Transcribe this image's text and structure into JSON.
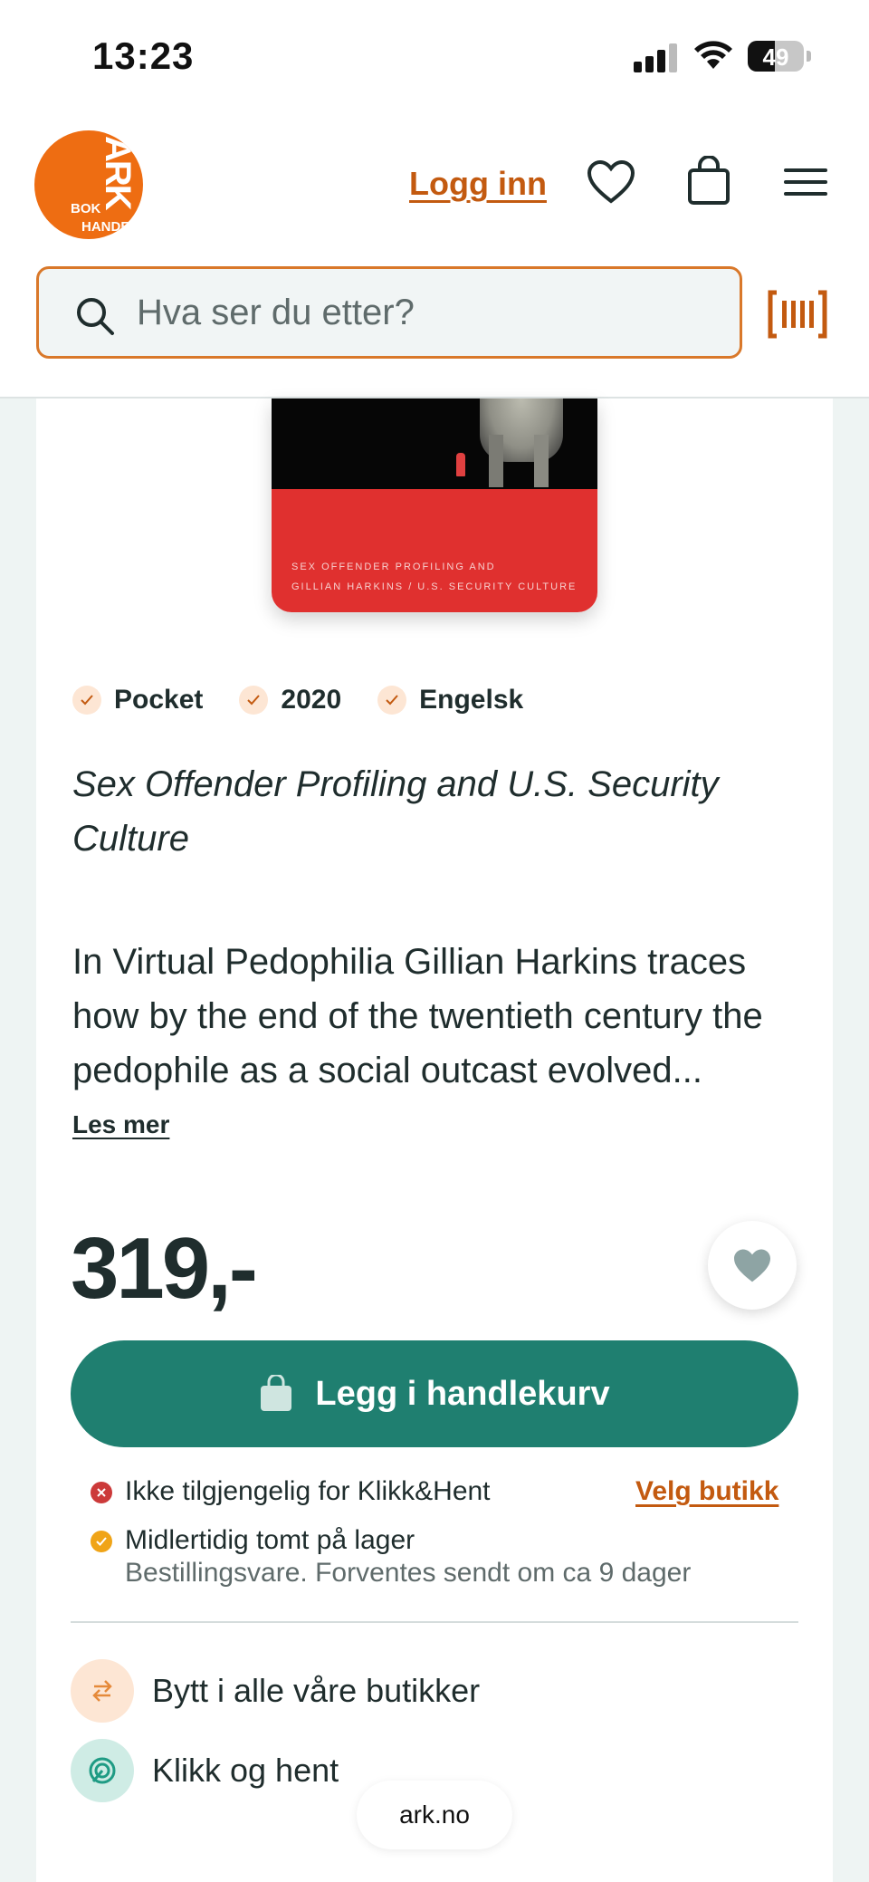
{
  "status": {
    "time": "13:23",
    "battery": "49"
  },
  "header": {
    "logo_top": "ARK",
    "logo_bottom1": "BOK",
    "logo_bottom2": "HANDEL",
    "login_label": "Logg inn",
    "search_placeholder": "Hva ser du etter?"
  },
  "book": {
    "cover_line1": "SEX OFFENDER PROFILING AND",
    "cover_line2": "GILLIAN HARKINS  /  U.S. SECURITY CULTURE",
    "chips": [
      "Pocket",
      "2020",
      "Engelsk"
    ],
    "title": "Sex Offender Profiling and U.S. Security Culture",
    "description": "In Virtual Pedophilia Gillian Harkins traces how by the end of the twentieth century the pedophile as a social outcast evolved...",
    "read_more": "Les mer",
    "price": "319,-"
  },
  "cart": {
    "add_label": "Legg i handlekurv"
  },
  "availability": {
    "pickup_text": "Ikke tilgjengelig for Klikk&Hent",
    "choose_store": "Velg butikk",
    "stock_text": "Midlertidig tomt på lager",
    "stock_sub": "Bestillingsvare. Forventes sendt om ca 9 dager",
    "pickup_color": "#cc3a3a",
    "stock_color": "#f0a417"
  },
  "features": [
    "Bytt i alle våre butikker",
    "Klikk og hent"
  ],
  "browser": {
    "url": "ark.no"
  },
  "colors": {
    "brand_orange": "#ee6d12",
    "accent_link": "#c35a10",
    "primary_green": "#1f7f70"
  }
}
